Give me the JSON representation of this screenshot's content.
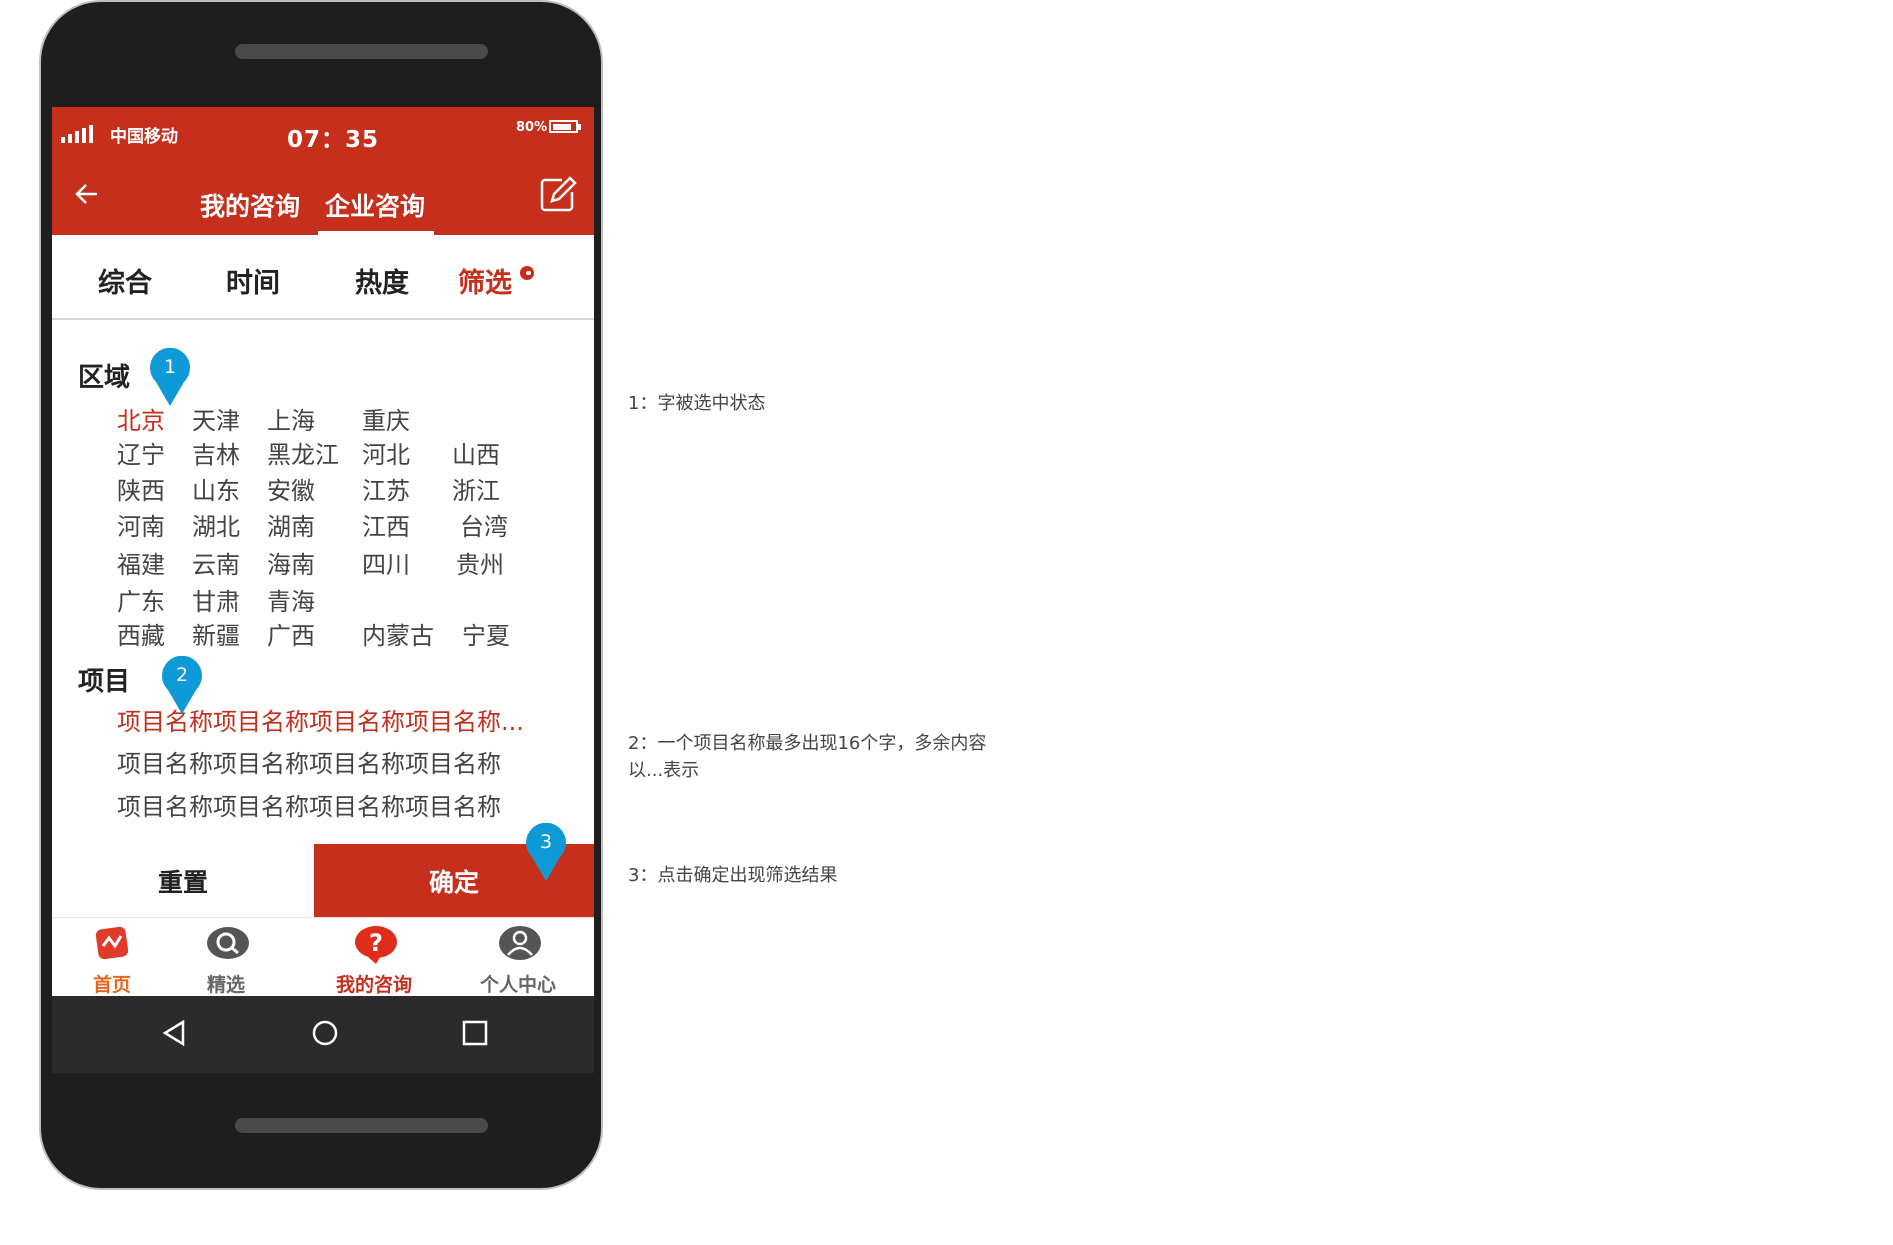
{
  "status_bar": {
    "carrier": "中国移动",
    "time": "07：35",
    "battery": "80%"
  },
  "nav": {
    "tab_mine": "我的咨询",
    "tab_enterprise": "企业咨询"
  },
  "sort": {
    "overall": "综合",
    "time": "时间",
    "heat": "热度",
    "filter": "筛选"
  },
  "region": {
    "title": "区域",
    "rows": [
      [
        "北京",
        "天津",
        "上海",
        "重庆"
      ],
      [
        "辽宁",
        "吉林",
        "黑龙江",
        "河北",
        "山西"
      ],
      [
        "陕西",
        "山东",
        "安徽",
        "江苏",
        "浙江"
      ],
      [
        "河南",
        "湖北",
        "湖南",
        "江西",
        "台湾"
      ],
      [
        "福建",
        "云南",
        "海南",
        "四川",
        "贵州"
      ],
      [
        "广东",
        "甘肃",
        "青海"
      ],
      [
        "西藏",
        "新疆",
        "广西",
        "内蒙古",
        "宁夏"
      ]
    ]
  },
  "project": {
    "title": "项目",
    "items": [
      "项目名称项目名称项目名称项目名称...",
      "项目名称项目名称项目名称项目名称",
      "项目名称项目名称项目名称项目名称"
    ]
  },
  "actions": {
    "reset": "重置",
    "confirm": "确定"
  },
  "tabbar": {
    "home": "首页",
    "featured": "精选",
    "my_consult": "我的咨询",
    "profile": "个人中心"
  },
  "markers": [
    "1",
    "2",
    "3"
  ],
  "notes": [
    "1：字被选中状态",
    "2：一个项目名称最多出现16个字，多余内容以...表示",
    "3：点击确定出现筛选结果"
  ],
  "colors": {
    "brand_red": "#c52f1c",
    "marker_blue": "#0e9ad6",
    "home_orange": "#e8661c"
  }
}
